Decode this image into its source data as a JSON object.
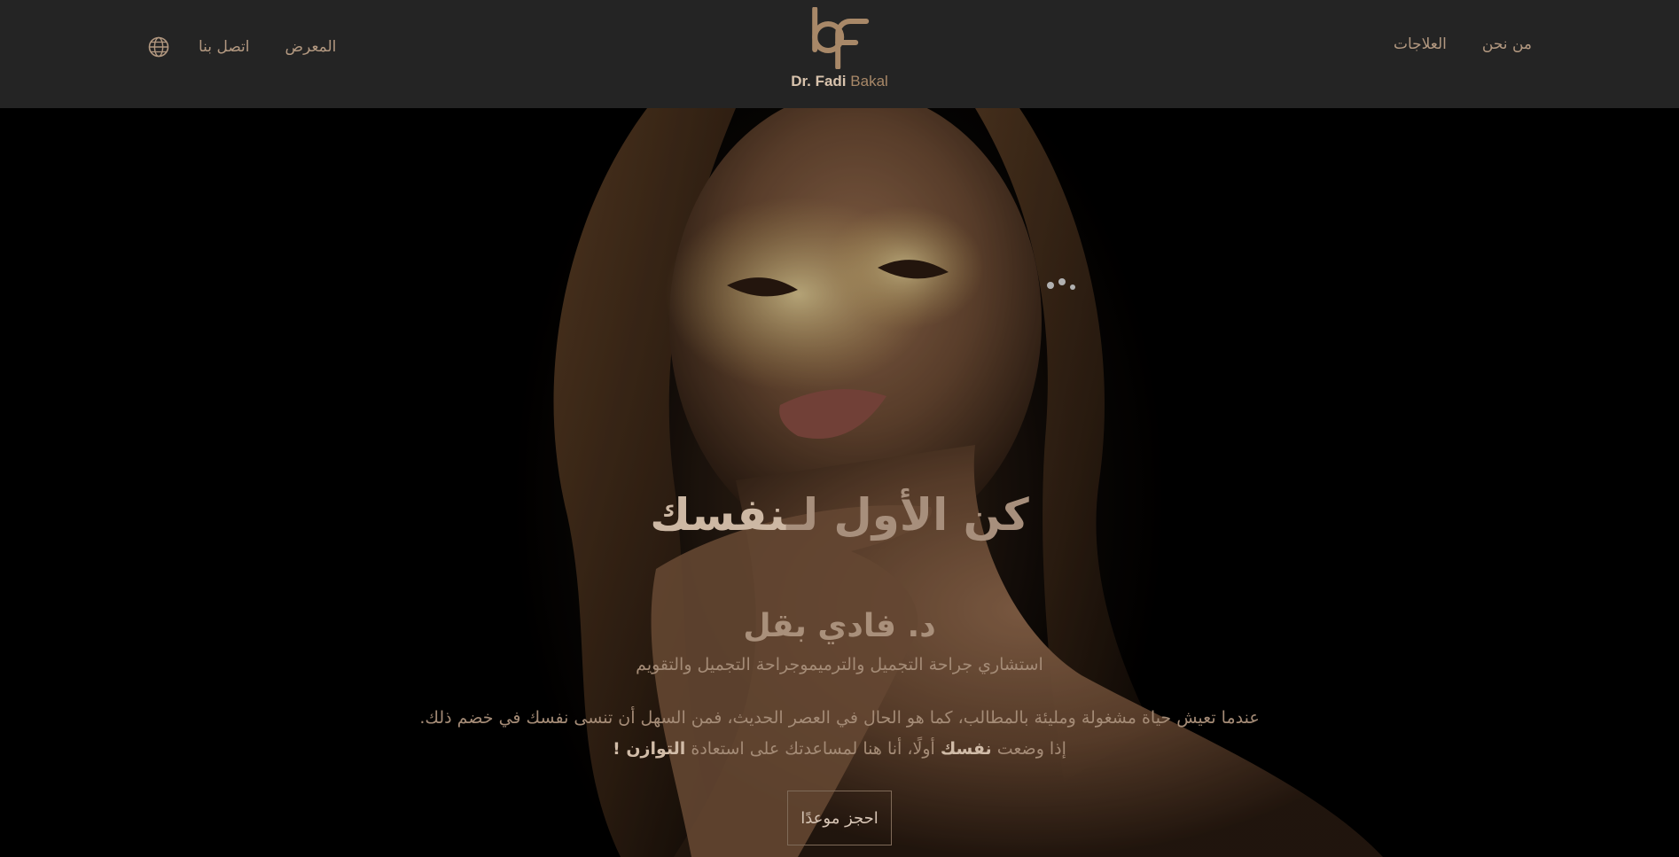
{
  "header": {
    "logo_brand": "Dr. Fadi",
    "logo_surname": "Bakal",
    "logo_icon": "bf-monogram-icon",
    "language_icon": "globe-icon",
    "nav_left": [
      "المعرض",
      "اتصل بنا"
    ],
    "nav_right": [
      "العلاجات",
      "من نحن"
    ]
  },
  "hero": {
    "tagline_light": "كن الأول لـ",
    "tagline_bold": "نفسك",
    "doctor_name": "د. فادي بقل",
    "doctor_title": "استشاري جراحة التجميل والترميموجراحة التجميل والتقويم",
    "intro_line1": "عندما تعيش حياة مشغولة ومليئة بالمطالب، كما هو الحال في العصر الحديث، فمن السهل أن تنسى نفسك في خضم ذلك.",
    "intro_line2_a": "إذا وضعت",
    "intro_line2_bold1": "نفسك",
    "intro_line2_b": "أولًا، أنا هنا لمساعدتك على استعادة",
    "intro_line2_bold2": "التوازن !",
    "book_button": "احجز موعدًا"
  },
  "colors": {
    "header_bg": "#242424",
    "accent_gold": "#b29880",
    "hero_bg": "#000000"
  }
}
